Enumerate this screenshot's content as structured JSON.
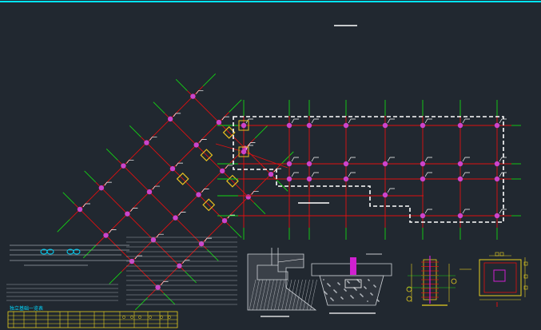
{
  "canvas": {
    "background": "#212830",
    "frame_color": "#00e5ff"
  },
  "colors": {
    "axis": "#e01010",
    "grid_ext": "#14d414",
    "column": "#cc44cc",
    "outline_dashed": "#ffffff",
    "annotation": "#ffffff",
    "highlight": "#e8c020",
    "text_block": "#9aa0a8",
    "table": "#e8d020",
    "cyan": "#00d8ff",
    "section_fill": "#cfd3d8",
    "detail_yellow": "#e8d020",
    "detail_red": "#e01010",
    "detail_green": "#14d414",
    "detail_magenta": "#d020d0"
  },
  "title_table": {
    "label": "独立基础一览表"
  },
  "legend": {
    "symbol": "ellipse-pair-icon"
  }
}
